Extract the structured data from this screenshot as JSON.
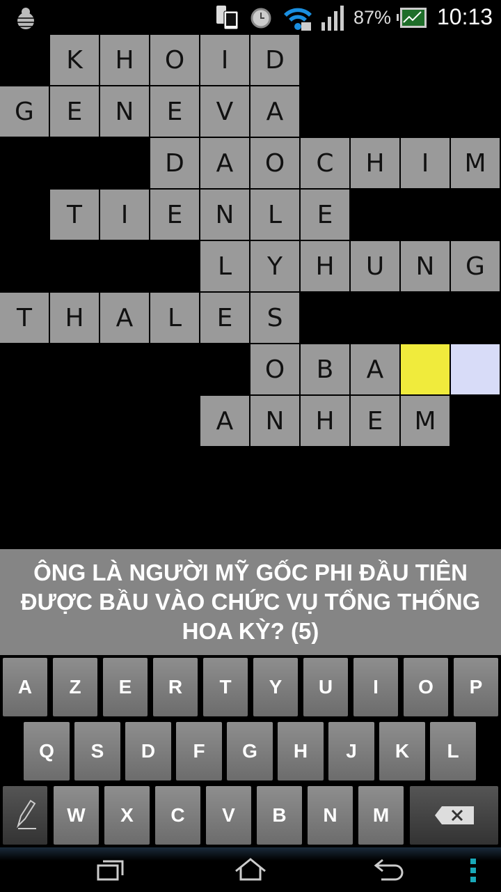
{
  "status": {
    "battery": "87%",
    "time": "10:13",
    "icons": [
      "debug-bug-icon",
      "phone-sync-icon",
      "alarm-icon",
      "wifi-lock-icon",
      "signal-icon",
      "battery-icon",
      "stock-app-icon"
    ]
  },
  "grid": {
    "colors": {
      "cell": "#9a9a9a",
      "active": "#f0eb3c",
      "cursor": "#d8dcf8"
    },
    "rows": [
      {
        "start": 1,
        "letters": [
          "K",
          "H",
          "O",
          "I",
          "D"
        ]
      },
      {
        "start": 0,
        "letters": [
          "G",
          "E",
          "N",
          "E",
          "V",
          "A"
        ]
      },
      {
        "start": 3,
        "letters": [
          "D",
          "A",
          "O",
          "C",
          "H",
          "I",
          "M"
        ]
      },
      {
        "start": 1,
        "letters": [
          "T",
          "I",
          "E",
          "N",
          "L",
          "E"
        ]
      },
      {
        "start": 4,
        "letters": [
          "L",
          "Y",
          "H",
          "U",
          "N",
          "G"
        ]
      },
      {
        "start": 0,
        "letters": [
          "T",
          "H",
          "A",
          "L",
          "E",
          "S"
        ]
      },
      {
        "start": 5,
        "letters": [
          "O",
          "B",
          "A",
          "",
          ""
        ],
        "highlight": {
          "3": "active",
          "4": "cursor"
        }
      },
      {
        "start": 4,
        "letters": [
          "A",
          "N",
          "H",
          "E",
          "M"
        ]
      }
    ]
  },
  "clue": "ÔNG LÀ NGƯỜI MỸ GỐC PHI ĐẦU TIÊN ĐƯỢC BẦU VÀO CHỨC VỤ TỔNG THỐNG HOA KỲ? (5)",
  "keyboard": {
    "rows": [
      [
        "A",
        "Z",
        "E",
        "R",
        "T",
        "Y",
        "U",
        "I",
        "O",
        "P"
      ],
      [
        "Q",
        "S",
        "D",
        "F",
        "G",
        "H",
        "J",
        "K",
        "L"
      ],
      [
        "W",
        "X",
        "C",
        "V",
        "B",
        "N",
        "M"
      ]
    ]
  },
  "nav": {
    "icons": [
      "recent-apps-icon",
      "home-icon",
      "back-icon",
      "menu-icon"
    ]
  }
}
